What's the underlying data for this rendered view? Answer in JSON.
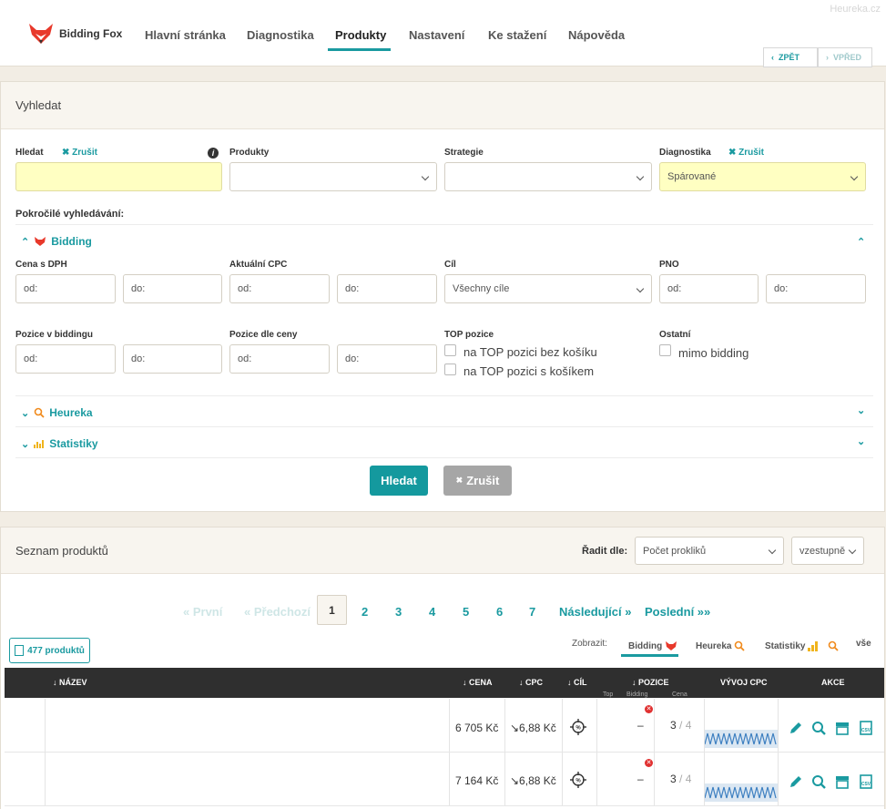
{
  "header": {
    "heureka": "Heureka.cz",
    "logo": "Bidding Fox",
    "nav": [
      "Hlavní stránka",
      "Diagnostika",
      "Produkty",
      "Nastavení",
      "Ke stažení",
      "Nápověda"
    ],
    "back": "ZPĚT",
    "forward": "VPŘED"
  },
  "search": {
    "title": "Vyhledat",
    "hledat_label": "Hledat",
    "clear": "Zrušit",
    "produkty_label": "Produkty",
    "strategie_label": "Strategie",
    "diagnostika_label": "Diagnostika",
    "diagnostika_value": "Spárované",
    "advanced": "Pokročilé vyhledávání:",
    "bidding": "Bidding",
    "cena_label": "Cena s DPH",
    "cpc_label": "Aktuální CPC",
    "cil_label": "Cíl",
    "cil_value": "Všechny cíle",
    "pno_label": "PNO",
    "od": "od:",
    "do": "do:",
    "pozice_bidding_label": "Pozice v biddingu",
    "pozice_ceny_label": "Pozice dle ceny",
    "top_label": "TOP pozice",
    "top_1": "na TOP pozici bez košíku",
    "top_2": "na TOP pozici s košíkem",
    "ostatni_label": "Ostatní",
    "mimo": "mimo bidding",
    "heureka": "Heureka",
    "statistiky": "Statistiky",
    "submit": "Hledat",
    "cancel": "Zrušit"
  },
  "list": {
    "title": "Seznam produktů",
    "sort_label": "Řadit dle:",
    "sort_value": "Počet prokliků",
    "order_value": "vzestupně",
    "pagination": {
      "first": "« První",
      "prev": "« Předchozí",
      "current": "1",
      "pages": [
        "2",
        "3",
        "4",
        "5",
        "6",
        "7"
      ],
      "next": "Následující »",
      "last": "Poslední »»"
    },
    "count": "477 produktů",
    "show_label": "Zobrazit:",
    "views": [
      "Bidding",
      "Heureka",
      "Statistiky",
      "vše"
    ]
  },
  "table": {
    "cols": {
      "nazev": "NÁZEV",
      "cena": "CENA",
      "cpc": "CPC",
      "cil": "CÍL",
      "pozice": "POZICE",
      "top": "Top",
      "bidding": "Bidding",
      "cena_sub": "Cena",
      "vyvoj": "VÝVOJ CPC",
      "akce": "AKCE"
    },
    "rows": [
      {
        "cena": "6 705 Kč",
        "cpc": "↘6,88 Kč",
        "bidding": "–",
        "pos": "3",
        "of": "/ 4"
      },
      {
        "cena": "7 164 Kč",
        "cpc": "↘6,88 Kč",
        "bidding": "–",
        "pos": "3",
        "of": "/ 4"
      }
    ]
  },
  "colors": {
    "accent": "#1a9aa0",
    "error": "#e03030"
  }
}
